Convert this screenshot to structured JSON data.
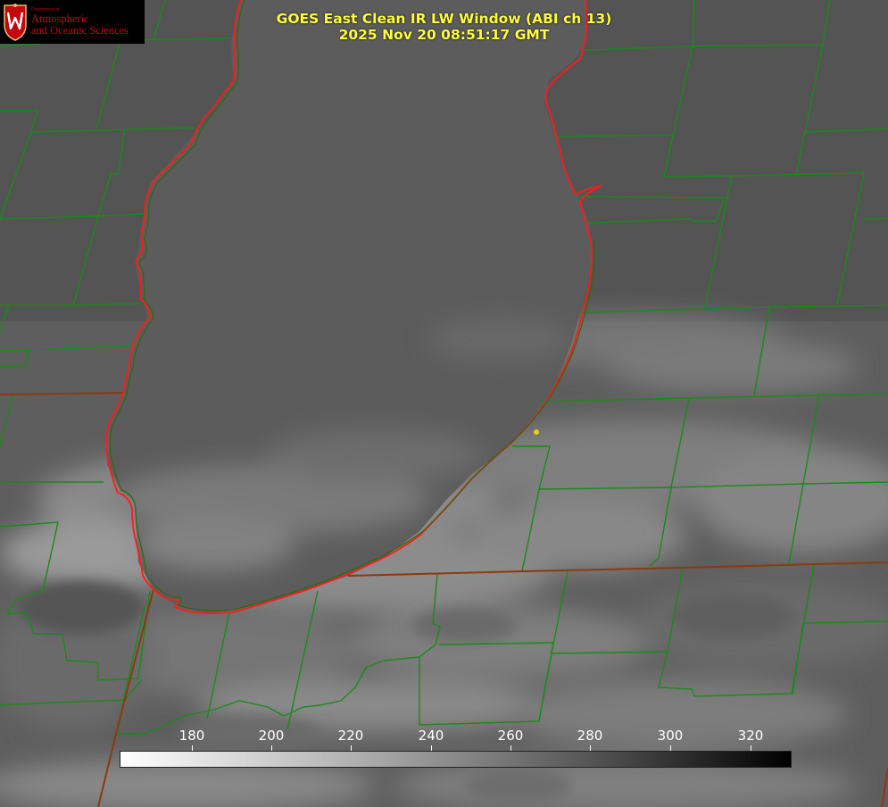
{
  "logo": {
    "icon": "uw-madison-crest-icon",
    "department_small": "Department of",
    "line1": "Atmospheric",
    "line2": "and Oceanic Sciences"
  },
  "title": {
    "line1": "GOES East Clean IR LW Window (ABI ch 13)",
    "line2": "2025 Nov 20 08:51:17 GMT"
  },
  "colorbar": {
    "ticks": [
      "180",
      "200",
      "220",
      "240",
      "260",
      "280",
      "300",
      "320"
    ],
    "gradient": "white-to-black"
  },
  "colors": {
    "county_lines": "#1a8a1a",
    "coastline": "#ff1a1a",
    "title_text": "#ffff3c",
    "logo_red": "#c5050c",
    "marker": "#e6d200"
  }
}
